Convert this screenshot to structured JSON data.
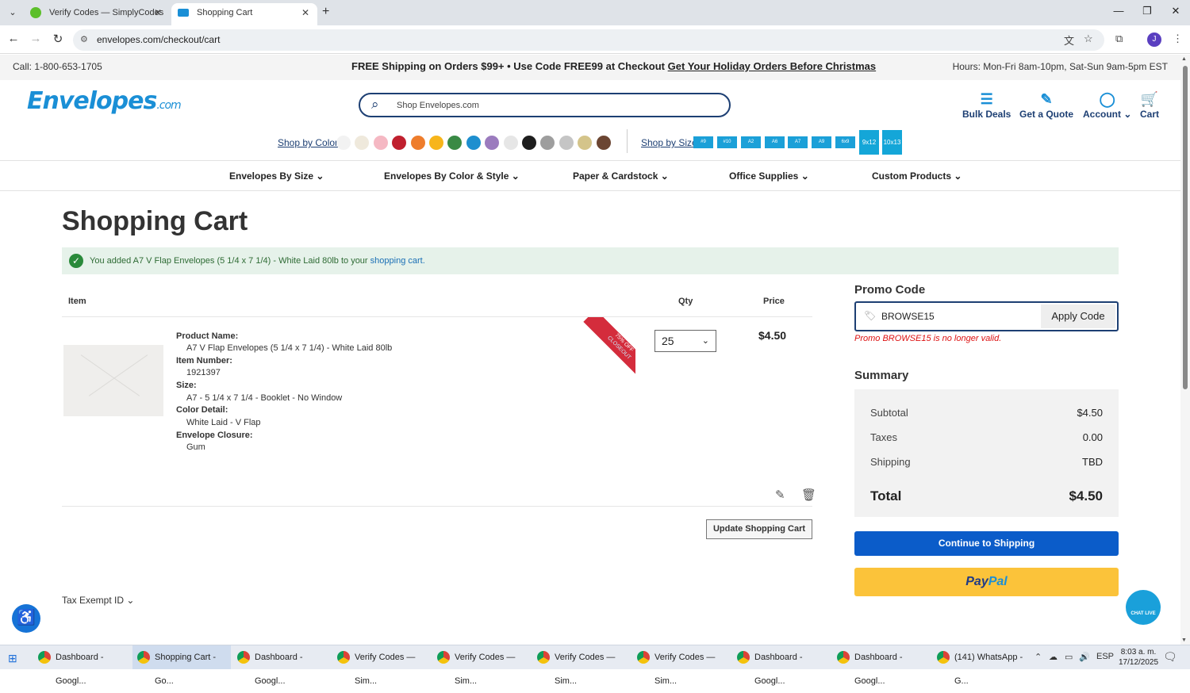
{
  "browser": {
    "tabs": [
      {
        "title": "Verify Codes — SimplyCodes",
        "active": false
      },
      {
        "title": "Shopping Cart",
        "active": true
      }
    ],
    "new_tab": "+",
    "url": "envelopes.com/checkout/cart",
    "profile_initial": "J"
  },
  "topbar": {
    "call": "Call: 1-800-653-1705",
    "promo_text": "FREE Shipping on Orders $99+ • Use Code FREE99 at Checkout",
    "promo_link": "Get Your Holiday Orders Before Christmas",
    "hours": "Hours: Mon-Fri 8am-10pm, Sat-Sun 9am-5pm EST"
  },
  "header": {
    "logo": "Envelopes",
    "logo_suffix": ".com",
    "search_placeholder": "Shop Envelopes.com",
    "actions": [
      {
        "label": "Bulk Deals",
        "icon": "stack-icon"
      },
      {
        "label": "Get a Quote",
        "icon": "pencil-square-icon"
      },
      {
        "label": "Account",
        "icon": "user-icon"
      },
      {
        "label": "Cart",
        "icon": "cart-icon"
      }
    ],
    "shop_by_color": "Shop by Color",
    "colors": [
      "#f2f2f2",
      "#efe9dc",
      "#f5b8c3",
      "#c0202e",
      "#ee7d2c",
      "#f7b51b",
      "#3a8a45",
      "#1e8fcf",
      "#9b7bbe",
      "#e6e6e6",
      "#1e1e1e",
      "#9e9e9e",
      "#c5c5c5",
      "#d4c48a",
      "#6b4532"
    ],
    "shop_by_size": "Shop by Size",
    "sizes": [
      "#9",
      "#10",
      "A2",
      "A6",
      "A7",
      "A9",
      "6x9",
      "9x12",
      "10x13"
    ]
  },
  "nav": [
    "Envelopes By Size",
    "Envelopes By Color & Style",
    "Paper & Cardstock",
    "Office Supplies",
    "Custom Products"
  ],
  "cart": {
    "title": "Shopping Cart",
    "added_msg": "You added A7 V Flap Envelopes (5 1/4 x 7 1/4) - White Laid 80lb to your",
    "added_link": "shopping cart.",
    "col_item": "Item",
    "col_qty": "Qty",
    "col_price": "Price",
    "item": {
      "product_name_label": "Product Name:",
      "product_name": "A7 V Flap Envelopes (5 1/4 x 7 1/4) - White Laid 80lb",
      "item_number_label": "Item Number:",
      "item_number": "1921397",
      "size_label": "Size:",
      "size": "A7 - 5 1/4 x 7 1/4 - Booklet - No Window",
      "color_label": "Color Detail:",
      "color": "White Laid - V Flap",
      "closure_label": "Envelope Closure:",
      "closure": "Gum",
      "ribbon_top": "75% OFF",
      "ribbon_bottom": "CLOSEOUT",
      "qty": "25",
      "price": "$4.50"
    },
    "update_button": "Update Shopping Cart",
    "tax_exempt": "Tax Exempt ID"
  },
  "sidebar": {
    "promo_heading": "Promo Code",
    "promo_value": "BROWSE15",
    "apply_button": "Apply Code",
    "promo_error": "Promo BROWSE15 is no longer valid.",
    "summary_heading": "Summary",
    "rows": [
      {
        "label": "Subtotal",
        "value": "$4.50"
      },
      {
        "label": "Taxes",
        "value": "0.00"
      },
      {
        "label": "Shipping",
        "value": "TBD"
      }
    ],
    "total_label": "Total",
    "total_value": "$4.50",
    "ship_button": "Continue to Shipping",
    "paypal_a": "Pay",
    "paypal_b": "Pal"
  },
  "chat": "CHAT LIVE",
  "taskbar": {
    "items": [
      "Dashboard - Googl...",
      "Shopping Cart - Go...",
      "Dashboard - Googl...",
      "Verify Codes — Sim...",
      "Verify Codes — Sim...",
      "Verify Codes — Sim...",
      "Verify Codes — Sim...",
      "Dashboard - Googl...",
      "Dashboard - Googl...",
      "(141) WhatsApp - G..."
    ],
    "lang": "ESP",
    "time": "8:03 a. m.",
    "date": "17/12/2025"
  }
}
